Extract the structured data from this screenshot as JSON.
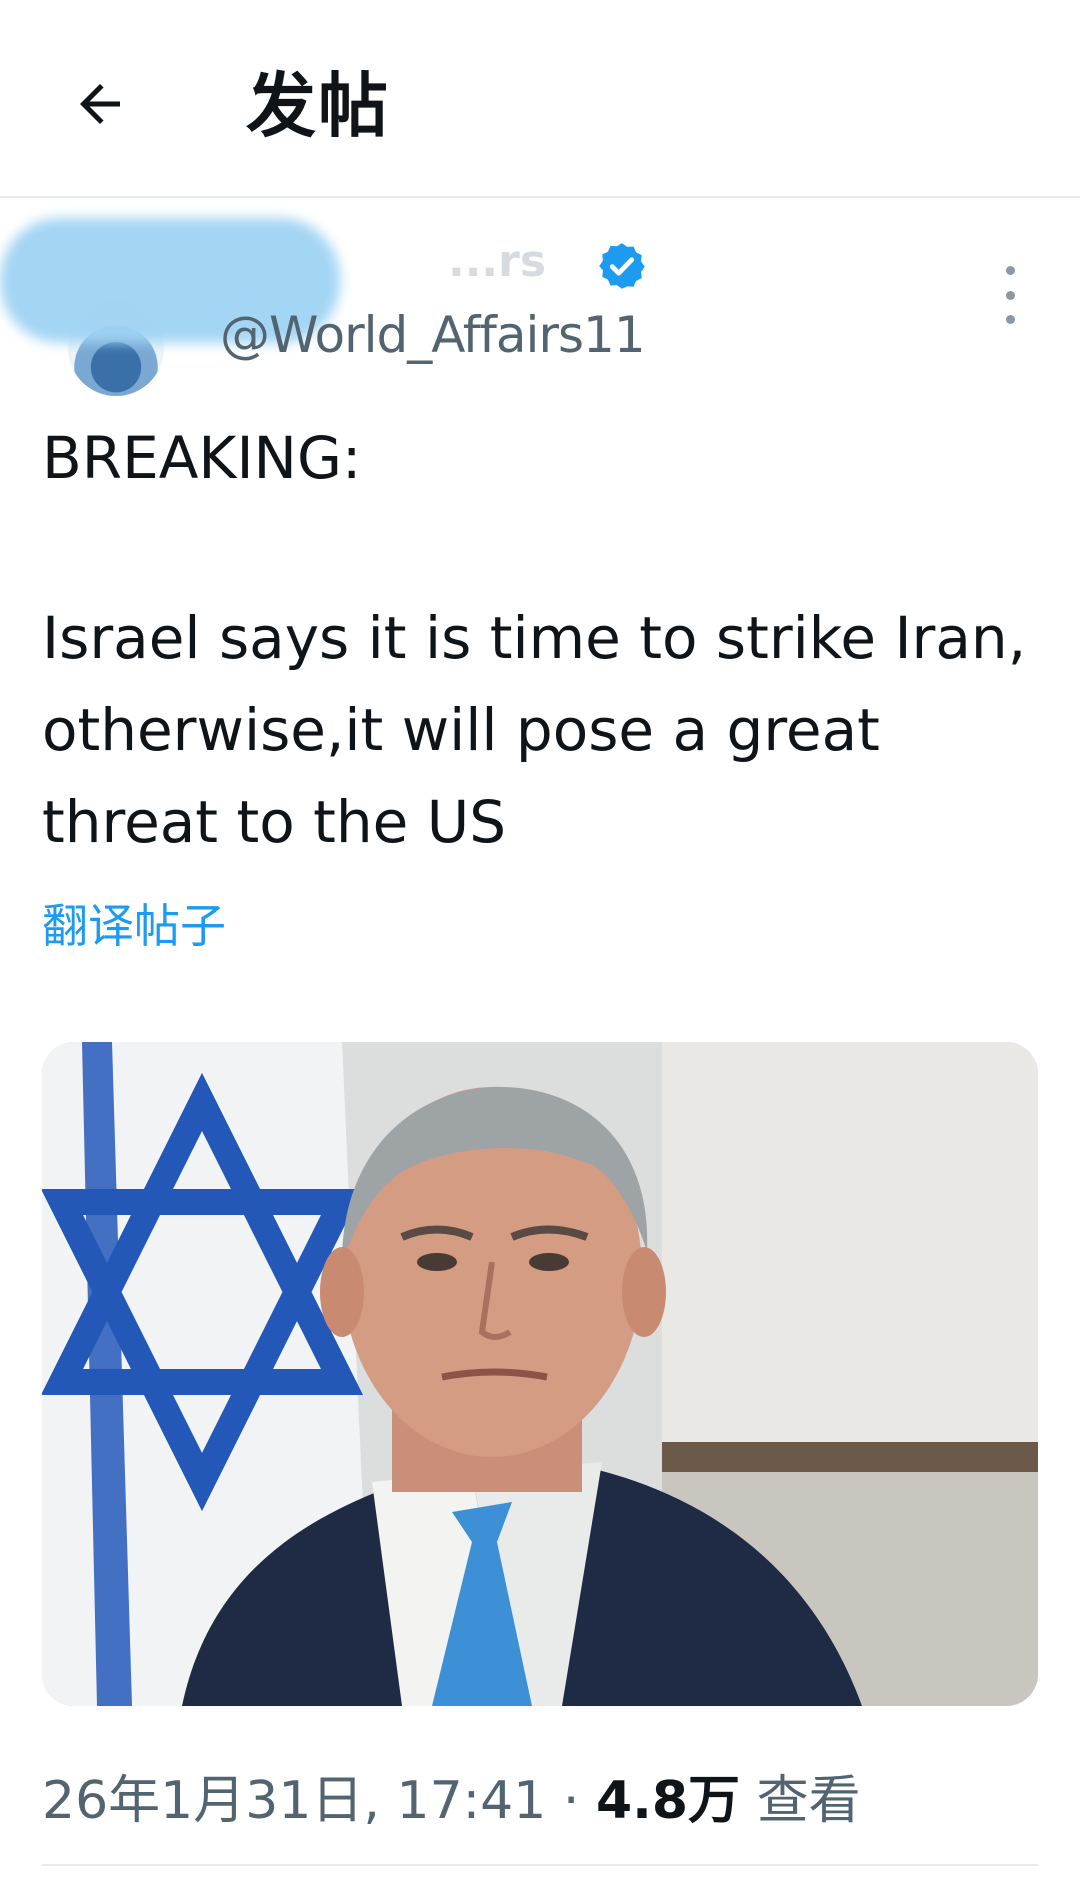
{
  "header": {
    "title": "发帖",
    "back_icon": "arrow-left-icon"
  },
  "author": {
    "display_name": "...rs",
    "handle": "@World_Affairs11",
    "verified_icon": "verified-badge-icon",
    "more_icon": "more-vertical-icon"
  },
  "post": {
    "line1": "BREAKING:",
    "body": "Israel says it is time to strike Iran, otherwise,it will pose a great threat to the US",
    "translate_label": "翻译帖子"
  },
  "media": {
    "alt": "photo"
  },
  "meta": {
    "timestamp": "26年1月31日, 17:41",
    "separator": "·",
    "views_count": "4.8万",
    "views_label": "查看"
  },
  "colors": {
    "accent": "#1d9bf0",
    "text_primary": "#0f1419",
    "text_secondary": "#536471",
    "divider": "#e6ecf0"
  }
}
